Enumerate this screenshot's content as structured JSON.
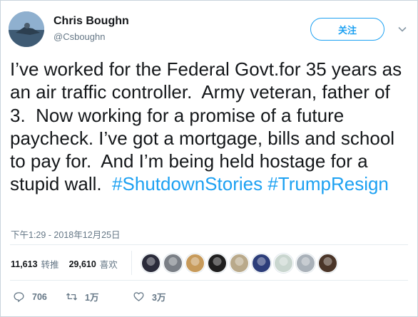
{
  "author": {
    "name": "Chris Boughn",
    "handle": "@Csboughn"
  },
  "follow_label": "关注",
  "tweet": {
    "text_parts": [
      {
        "type": "text",
        "value": "I’ve worked for the Federal Govt.for 35 years as an air traffic controller.  Army veteran, father of 3.  Now working for a promise of a future paycheck. I’ve got a mortgage, bills and school to pay for.  And I’m being held hostage for a stupid wall.  "
      },
      {
        "type": "hashtag",
        "value": "#ShutdownStories"
      },
      {
        "type": "text",
        "value": " "
      },
      {
        "type": "hashtag",
        "value": "#TrumpResign"
      }
    ],
    "timestamp": "下午1:29 - 2018年12月25日"
  },
  "stats": {
    "retweets_count": "11,613",
    "retweets_label": "转推",
    "likes_count": "29,610",
    "likes_label": "喜欢"
  },
  "liker_avatar_colors": [
    "#2a2b3a",
    "#7a7f86",
    "#c79a5a",
    "#1f1f1f",
    "#b9a98a",
    "#2c3d7a",
    "#c9d6cf",
    "#a9b1b9",
    "#4a3528"
  ],
  "actions": {
    "reply_count": "706",
    "retweet_count": "1万",
    "like_count": "3万"
  },
  "icons": {
    "caret": "chevron-down-icon",
    "reply": "reply-icon",
    "retweet": "retweet-icon",
    "like": "heart-icon"
  }
}
